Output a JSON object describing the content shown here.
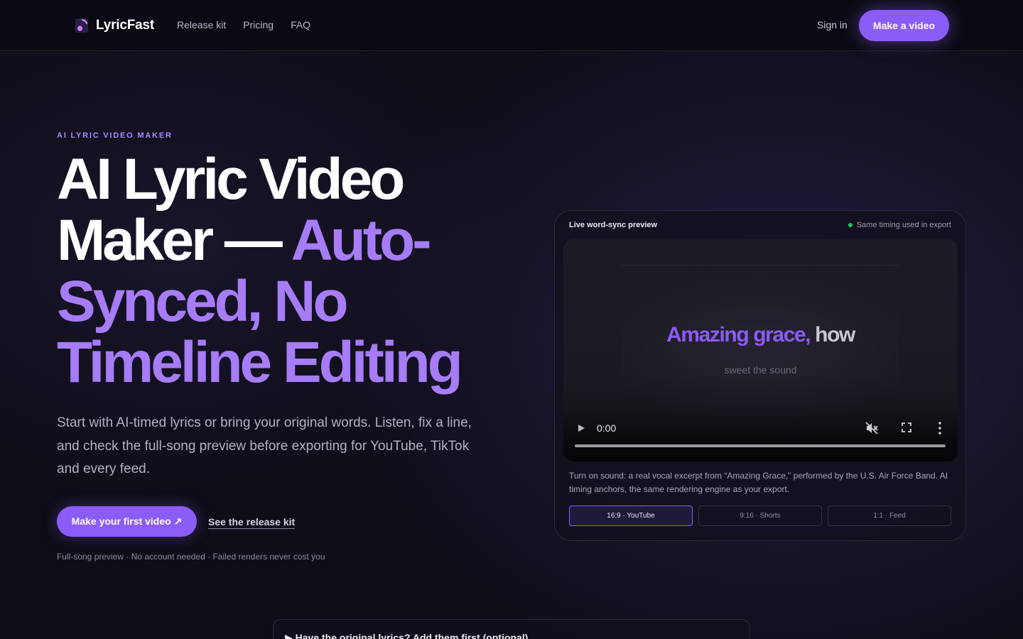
{
  "nav": {
    "brand": "LyricFast",
    "links": [
      "Release kit",
      "Pricing",
      "FAQ"
    ],
    "sign_in": "Sign in",
    "cta": "Make a video"
  },
  "hero": {
    "eyebrow": "AI LYRIC VIDEO MAKER",
    "headline_white": "AI Lyric Video Maker — ",
    "headline_accent": "Auto-Synced, No Timeline Editing",
    "subtext": "Start with AI-timed lyrics or bring your original words. Listen, fix a line, and check the full-song preview before exporting for YouTube, TikTok and every feed.",
    "cta_primary": "Make your first video ↗",
    "cta_secondary": "See the release kit",
    "fineprint": "Full-song preview · No account needed · Failed renders never cost you"
  },
  "preview": {
    "title": "Live word-sync preview",
    "status": "Same timing used in export",
    "lyric_sung": "Amazing grace,",
    "lyric_unsung": " how",
    "lyric_next": "sweet the sound",
    "time": "0:00",
    "progress": 0,
    "caption": "Turn on sound: a real vocal excerpt from “Amazing Grace,” performed by the U.S. Air Force Band. AI timing anchors, the same rendering engine as your export.",
    "ratios": [
      "16:9 · YouTube",
      "9:16 · Shorts",
      "1:1 · Feed"
    ],
    "active_ratio": "16:9 · YouTube"
  },
  "disclosure": {
    "label": "▶ Have the original lyrics? Add them first (optional)"
  },
  "colors": {
    "accent": "#8b5cf6",
    "accent_text": "#a67cf7",
    "status_dot": "#22c55e",
    "background": "#0f0d18"
  }
}
